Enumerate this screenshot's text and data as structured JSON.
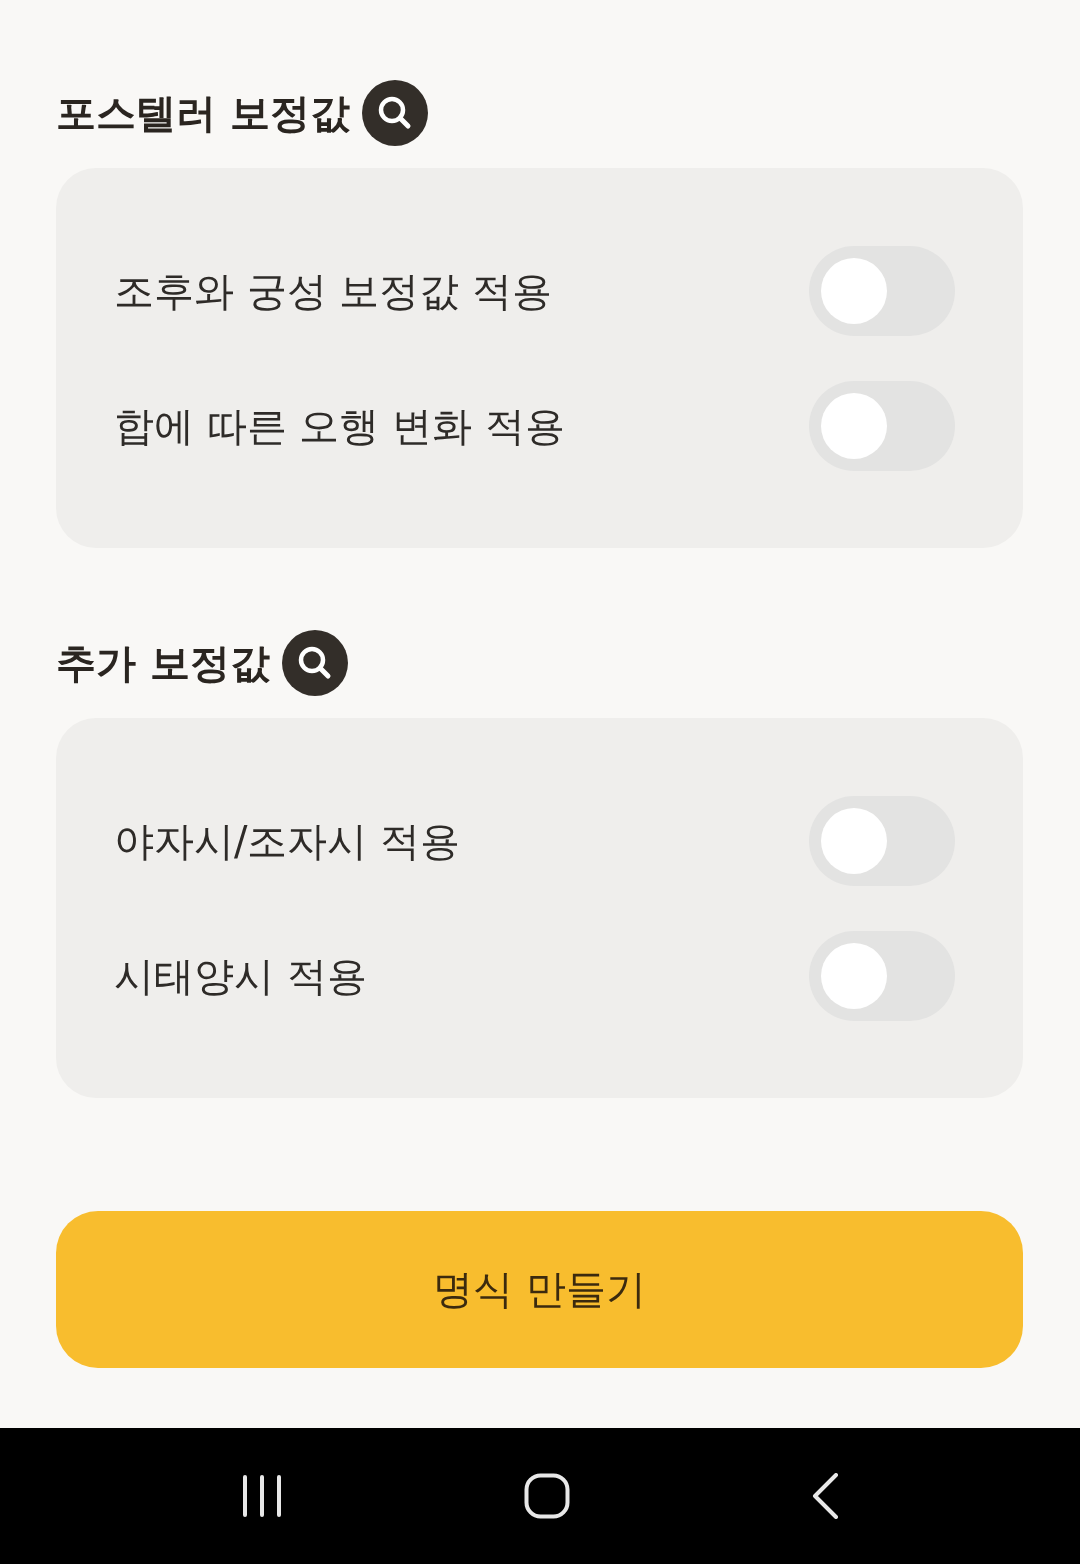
{
  "sections": [
    {
      "title": "포스텔러 보정값",
      "options": [
        {
          "label": "조후와 궁성 보정값 적용",
          "on": false
        },
        {
          "label": "합에 따른 오행 변화 적용",
          "on": false
        }
      ]
    },
    {
      "title": "추가 보정값",
      "options": [
        {
          "label": "야자시/조자시 적용",
          "on": false
        },
        {
          "label": "시태양시 적용",
          "on": false
        }
      ]
    }
  ],
  "primary_button": "명식 만들기"
}
